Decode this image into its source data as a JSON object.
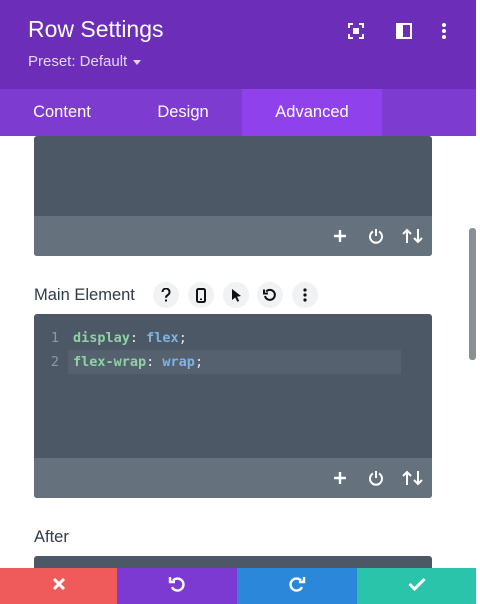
{
  "header": {
    "title": "Row Settings",
    "preset_label": "Preset: Default"
  },
  "tabs": [
    {
      "label": "Content",
      "active": false
    },
    {
      "label": "Design",
      "active": false
    },
    {
      "label": "Advanced",
      "active": true
    }
  ],
  "sections": {
    "main_element": {
      "label": "Main Element",
      "code_lines": [
        {
          "number": "1",
          "property": "display",
          "value": "flex"
        },
        {
          "number": "2",
          "property": "flex-wrap",
          "value": "wrap"
        }
      ]
    },
    "after": {
      "label": "After"
    }
  },
  "colors": {
    "header_bg": "#6c2eb9",
    "tabs_bg": "#7e3bd0",
    "active_tab_bg": "#8f42ec",
    "editor_bg": "#4c5866",
    "editor_bar_bg": "#66717e",
    "discard": "#ef5a5a",
    "undo": "#7c3ad3",
    "redo": "#2b87da",
    "save": "#29c4a9"
  },
  "footer": {
    "buttons": [
      "close-icon",
      "undo-icon",
      "redo-icon",
      "check-icon"
    ]
  }
}
